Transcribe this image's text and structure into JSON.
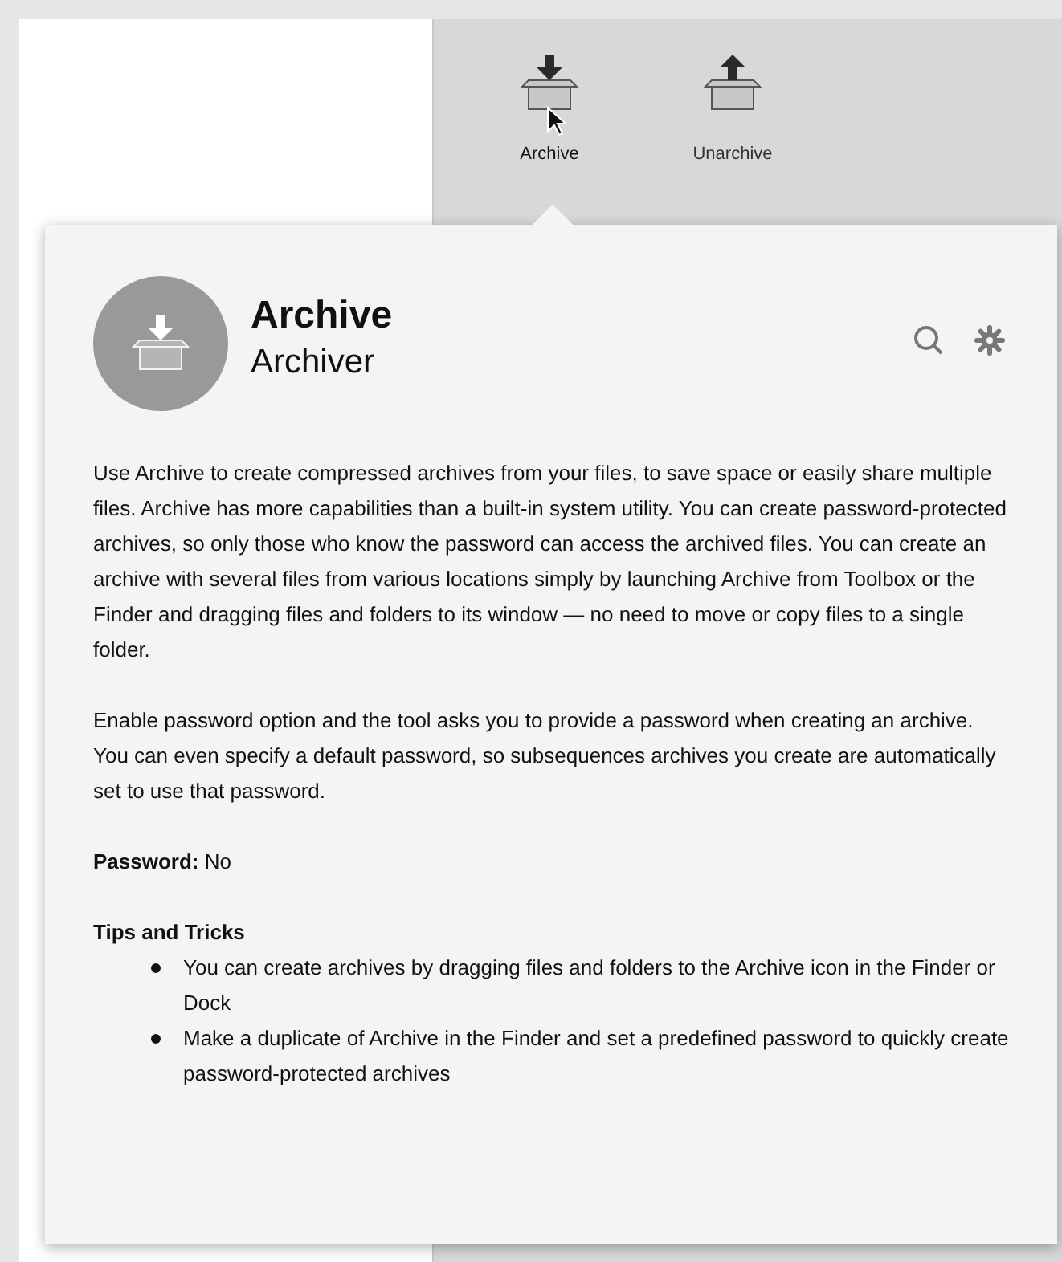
{
  "toolbar": {
    "items": [
      {
        "label": "Archive",
        "kind": "archive",
        "selected": true
      },
      {
        "label": "Unarchive",
        "kind": "unarchive",
        "selected": false
      }
    ]
  },
  "popover": {
    "title": "Archive",
    "subtitle": "Archiver",
    "paragraphs": [
      "Use Archive to create compressed archives from your files, to save space or easily share multiple files. Archive has more capabilities than a built-in system utility. You can create password-protected archives, so only those who know the password can access the archived files. You can create an archive with several files from various locations simply by launching Archive from Toolbox or the Finder and dragging files and folders to its window — no need to move or copy files to a single folder.",
      "Enable password option and the tool asks you to provide a password when creating an archive. You can even specify a default password, so subsequences archives you create are automatically set to use that password.",
      "**Password:** No"
    ],
    "tips_heading": "Tips and Tricks",
    "tips": [
      "You can create archives by dragging files and folders to the Archive icon in the Finder or Dock",
      "Make a duplicate of Archive in the Finder and set a predefined password to quickly create password-protected archives"
    ]
  }
}
